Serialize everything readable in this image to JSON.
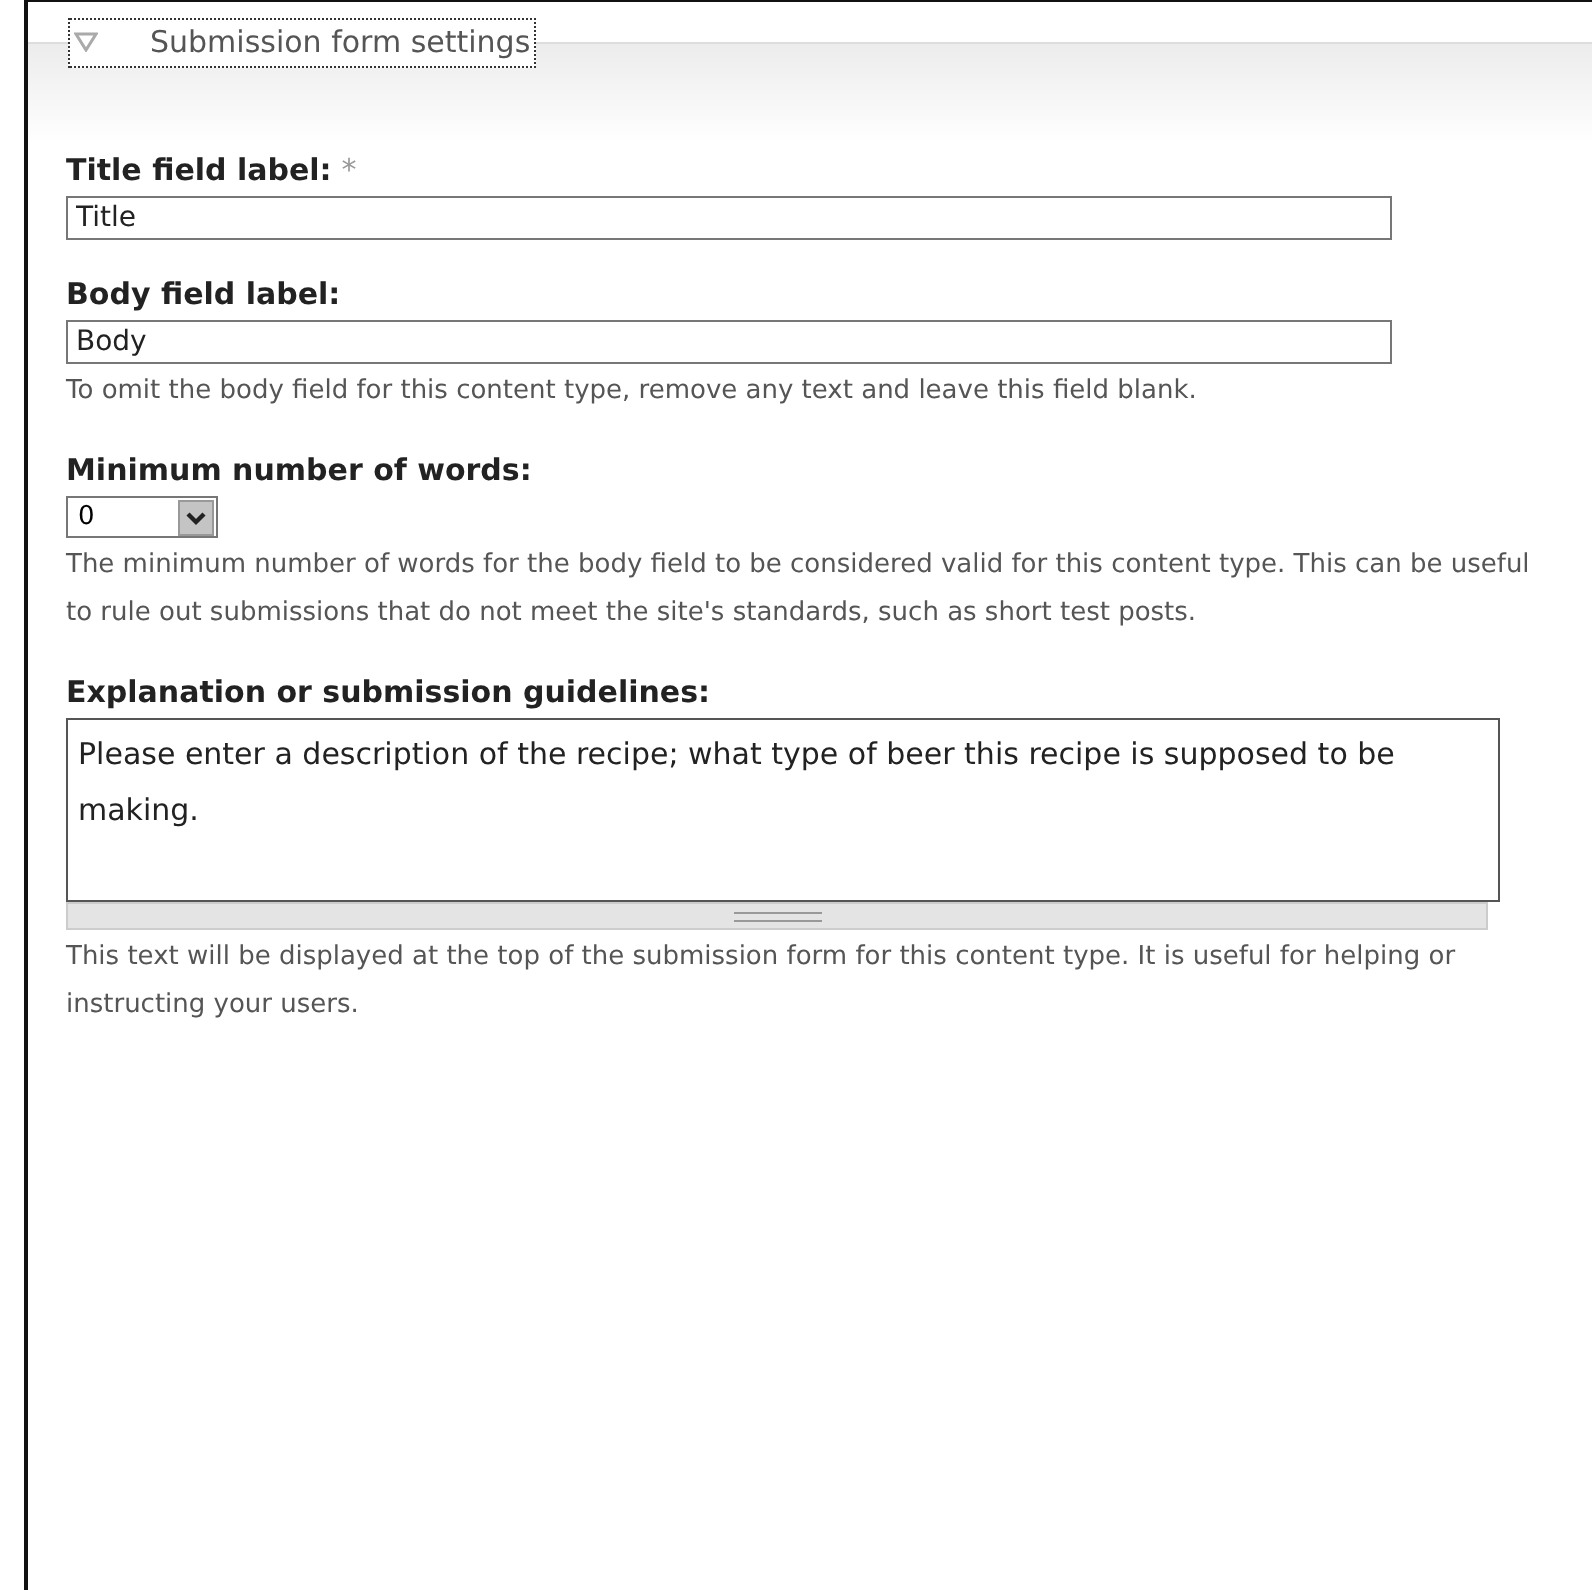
{
  "fieldset": {
    "legend": "Submission form settings",
    "expanded": true
  },
  "fields": [
    {
      "kind": "text",
      "label": "Title field label:",
      "required_mark": "*",
      "value": "Title"
    },
    {
      "kind": "text",
      "label": "Body field label:",
      "value": "Body",
      "description": "To omit the body field for this content type, remove any text and leave this field blank."
    },
    {
      "kind": "select",
      "label": "Minimum number of words:",
      "value": "0",
      "description": "The minimum number of words for the body field to be considered valid for this content type. This can be useful to rule out submissions that do not meet the site's standards, such as short test posts."
    },
    {
      "kind": "textarea",
      "label": "Explanation or submission guidelines:",
      "value": "Please enter a description of the recipe; what type of beer this recipe is supposed to be making.",
      "description": "This text will be displayed at the top of the submission form for this content type. It is useful for helping or instructing your users."
    }
  ]
}
